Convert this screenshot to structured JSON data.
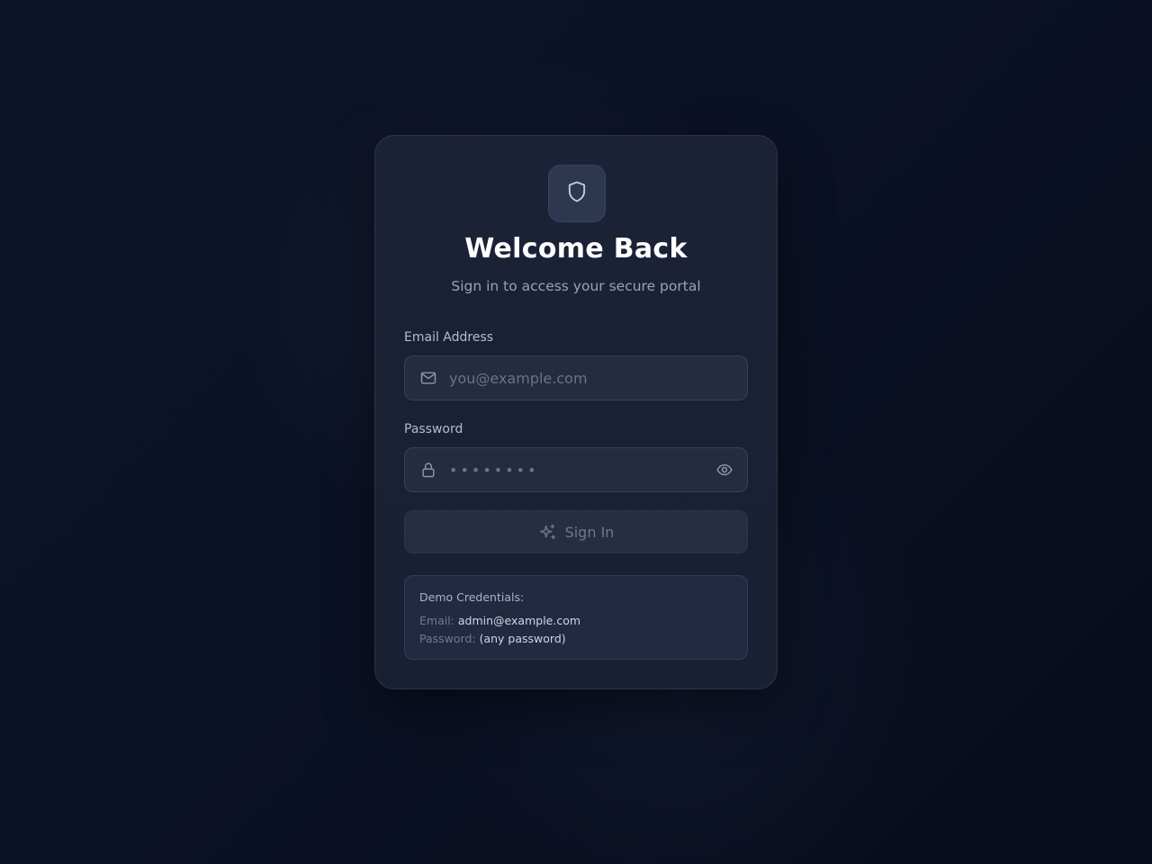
{
  "header": {
    "logo_icon": "shield-icon",
    "title": "Welcome Back",
    "subtitle": "Sign in to access your secure portal"
  },
  "form": {
    "email": {
      "label": "Email Address",
      "placeholder": "you@example.com",
      "value": "",
      "icon": "mail-icon"
    },
    "password": {
      "label": "Password",
      "placeholder": "••••••••",
      "value": "",
      "icon": "lock-icon",
      "toggle_icon": "eye-icon"
    },
    "submit": {
      "label": "Sign In",
      "icon": "sparkles-icon"
    }
  },
  "demo": {
    "heading": "Demo Credentials:",
    "email_key": "Email:",
    "email_value": "admin@example.com",
    "password_key": "Password:",
    "password_value": "(any password)"
  },
  "colors": {
    "background": "#0c1226",
    "card": "#1c2236",
    "input": "#252b40",
    "text_primary": "#ffffff",
    "text_muted": "#9aa3b8"
  }
}
